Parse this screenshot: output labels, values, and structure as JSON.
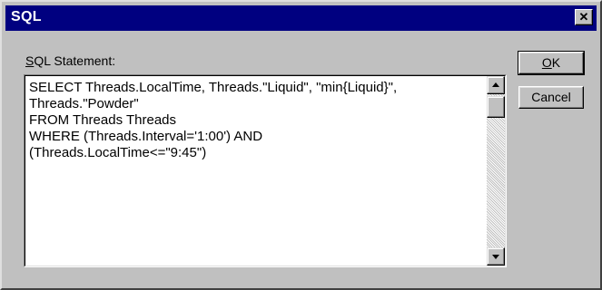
{
  "window": {
    "title": "SQL",
    "close_glyph": "✕"
  },
  "label": {
    "accel": "S",
    "rest": "QL Statement:"
  },
  "sql_text": "SELECT Threads.LocalTime, Threads.\"Liquid\", \"min{Liquid}\",\nThreads.\"Powder\"\nFROM Threads Threads\nWHERE (Threads.Interval='1:00') AND\n(Threads.LocalTime<=\"9:45\")",
  "buttons": {
    "ok": {
      "accel": "O",
      "rest": "K"
    },
    "cancel": "Cancel"
  },
  "icons": {
    "scroll_up": "scroll-up-arrow-icon",
    "scroll_down": "scroll-down-arrow-icon"
  }
}
